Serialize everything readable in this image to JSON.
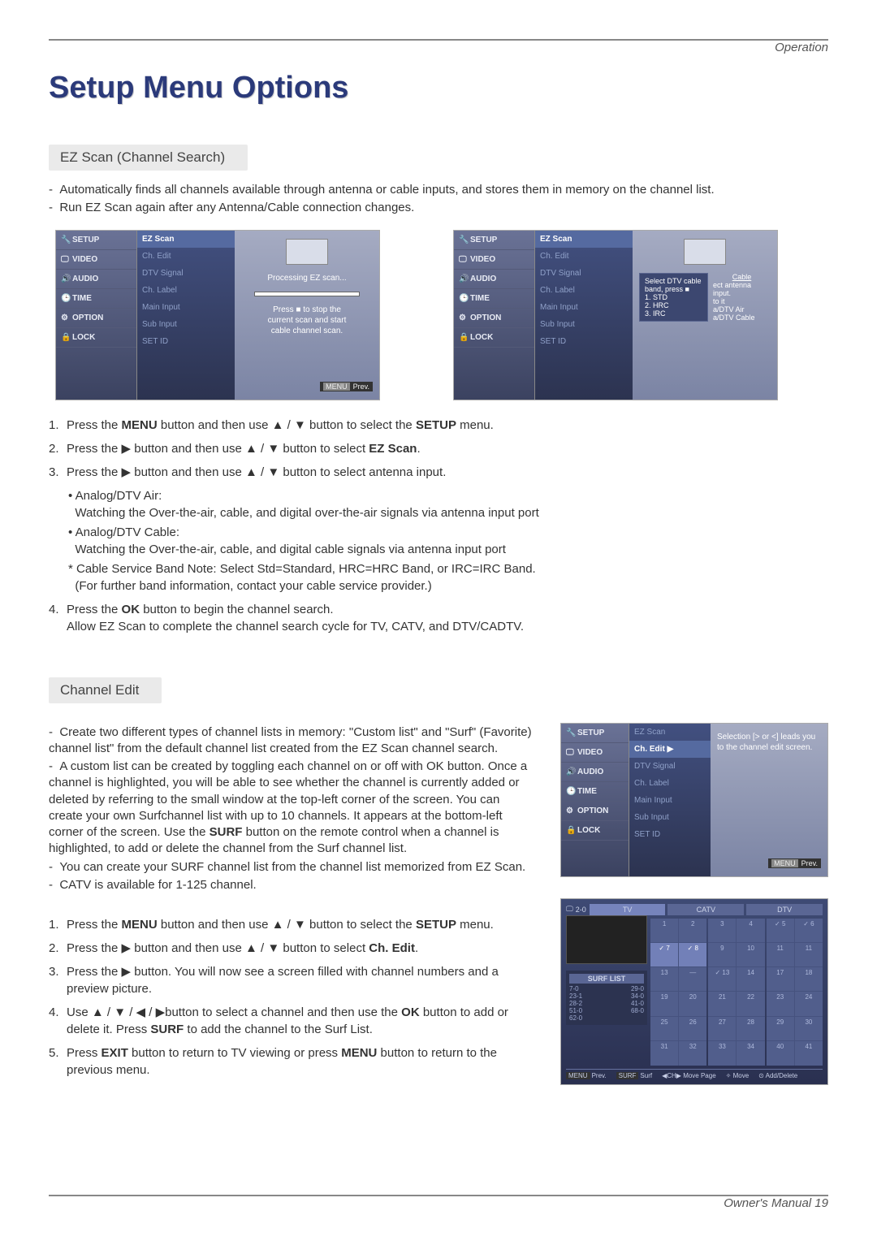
{
  "header": {
    "section": "Operation"
  },
  "title": "Setup Menu Options",
  "ezscan": {
    "header": "EZ Scan (Channel Search)",
    "intro1": "Automatically finds all channels available through antenna or cable inputs, and stores them in memory on the channel list.",
    "intro2": "Run EZ Scan again after any Antenna/Cable connection changes.",
    "sidebar": [
      "SETUP",
      "VIDEO",
      "AUDIO",
      "TIME",
      "OPTION",
      "LOCK"
    ],
    "centerItems": [
      "EZ Scan",
      "Ch. Edit",
      "DTV Signal",
      "Ch. Label",
      "Main Input",
      "Sub Input",
      "SET ID"
    ],
    "right1a": "Processing EZ scan...",
    "right1b": "Press ■ to stop the",
    "right1c": "current scan and start",
    "right1d": "cable channel scan.",
    "prev": "Prev.",
    "right2top": "Select DTV cable band, press ■",
    "right2cable": "Cable",
    "right2col2a": "ect antenna input.",
    "right2row1": "1. STD",
    "right2row2": "2. HRC",
    "right2row3": "3. IRC",
    "right2col2b": "to it",
    "right2opt1": "a/DTV Air",
    "right2opt2": "a/DTV Cable",
    "step1a": "Press the ",
    "step1b": "MENU",
    "step1c": " button and then use ▲ / ▼ button to select the ",
    "step1d": "SETUP",
    "step1e": " menu.",
    "step2a": "Press the ▶ button and then use ▲ / ▼ button to select ",
    "step2b": "EZ Scan",
    "step2c": ".",
    "step3": "Press the ▶ button and then use ▲ / ▼ button to select antenna input.",
    "sb1a": "• Analog/DTV Air:",
    "sb1b": "Watching the Over-the-air, cable, and digital over-the-air signals via antenna input port",
    "sb2a": "• Analog/DTV Cable:",
    "sb2b": "Watching the Over-the-air, cable, and digital cable signals via antenna input port",
    "sb3a": "* Cable Service Band Note: Select Std=Standard, HRC=HRC Band, or IRC=IRC Band.",
    "sb3b": "(For further band information, contact your cable service provider.)",
    "step4a": "Press the ",
    "step4b": "OK",
    "step4c": " button to begin the channel search.",
    "step4d": "Allow EZ Scan to complete the channel search cycle for TV, CATV, and DTV/CADTV."
  },
  "chedit": {
    "header": "Channel Edit",
    "p1": "Create two different types of channel lists in memory: \"Custom list\" and \"Surf\" (Favorite) channel list\" from the default channel list created from the EZ Scan channel search.",
    "p2a": "A custom list can be created by toggling each channel on or off with OK button. Once a channel is highlighted, you will be able to see whether the channel is currently added or deleted by referring to the small window at the top-left corner of the screen. You can create your own Surfchannel list with up to 10 channels. It appears at the bottom-left corner of the screen. Use the ",
    "p2b": "SURF",
    "p2c": " button on the remote control when a channel is highlighted, to add or delete the channel from the Surf channel list.",
    "p3": "You can create your SURF channel list from the channel list memorized from EZ Scan.",
    "p4": "CATV is available for 1-125 channel.",
    "rightTip1": "Selection [> or <] leads you",
    "rightTip2": "to the channel edit screen.",
    "s1a": "Press the ",
    "s1b": "MENU",
    "s1c": " button and then use ▲ / ▼  button to select the ",
    "s1d": "SETUP",
    "s1e": " menu.",
    "s2a": "Press the ▶ button and then use ▲ / ▼ button to select ",
    "s2b": "Ch. Edit",
    "s2c": ".",
    "s3": "Press the ▶ button. You will now see a screen filled with channel numbers and a preview picture.",
    "s4a": "Use ▲ / ▼ / ◀ / ▶button to select a channel and then use the ",
    "s4b": "OK",
    "s4c": " button to add or delete it. Press ",
    "s4d": "SURF",
    "s4e": " to add the channel to the Surf List.",
    "s5a": "Press ",
    "s5b": "EXIT",
    "s5c": " button to return to TV viewing or press ",
    "s5d": "MENU",
    "s5e": " button to return to the previous menu.",
    "gridTop": "2-0",
    "tabs": [
      "TV",
      "CATV",
      "DTV"
    ],
    "surfTitle": "SURF LIST",
    "surfRows": [
      [
        "7-0",
        "29-0"
      ],
      [
        "23-1",
        "34-0"
      ],
      [
        "28-2",
        "41-0"
      ],
      [
        "51-0",
        "68-0"
      ],
      [
        "62-0",
        ""
      ]
    ],
    "foot1": "Prev.",
    "foot2": "Surf",
    "foot3": "Move Page",
    "foot4": "Move",
    "foot5": "Add/Delete"
  },
  "footer": "Owner's Manual   19"
}
